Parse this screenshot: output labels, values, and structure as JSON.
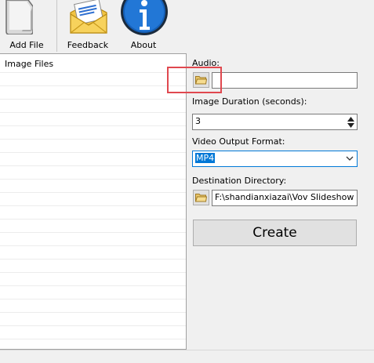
{
  "toolbar": {
    "add_file": {
      "label": "Add File",
      "icon": "document-icon"
    },
    "feedback": {
      "label": "Feedback",
      "icon": "envelope-icon"
    },
    "about": {
      "label": "About",
      "icon": "info-icon"
    }
  },
  "file_list": {
    "header": "Image Files"
  },
  "audio": {
    "label": "Audio:",
    "value": ""
  },
  "image_duration": {
    "label": "Image Duration (seconds):",
    "value": "3"
  },
  "video_output_format": {
    "label": "Video Output Format:",
    "selected": "MP4"
  },
  "destination_directory": {
    "label": "Destination Directory:",
    "value": "F:\\shandianxiazai\\Vov Slideshow Crea"
  },
  "create_button": {
    "label": "Create"
  },
  "colors": {
    "highlight_border": "#e0484f",
    "selection_bg": "#0078d7",
    "info_blue": "#1560b8"
  }
}
